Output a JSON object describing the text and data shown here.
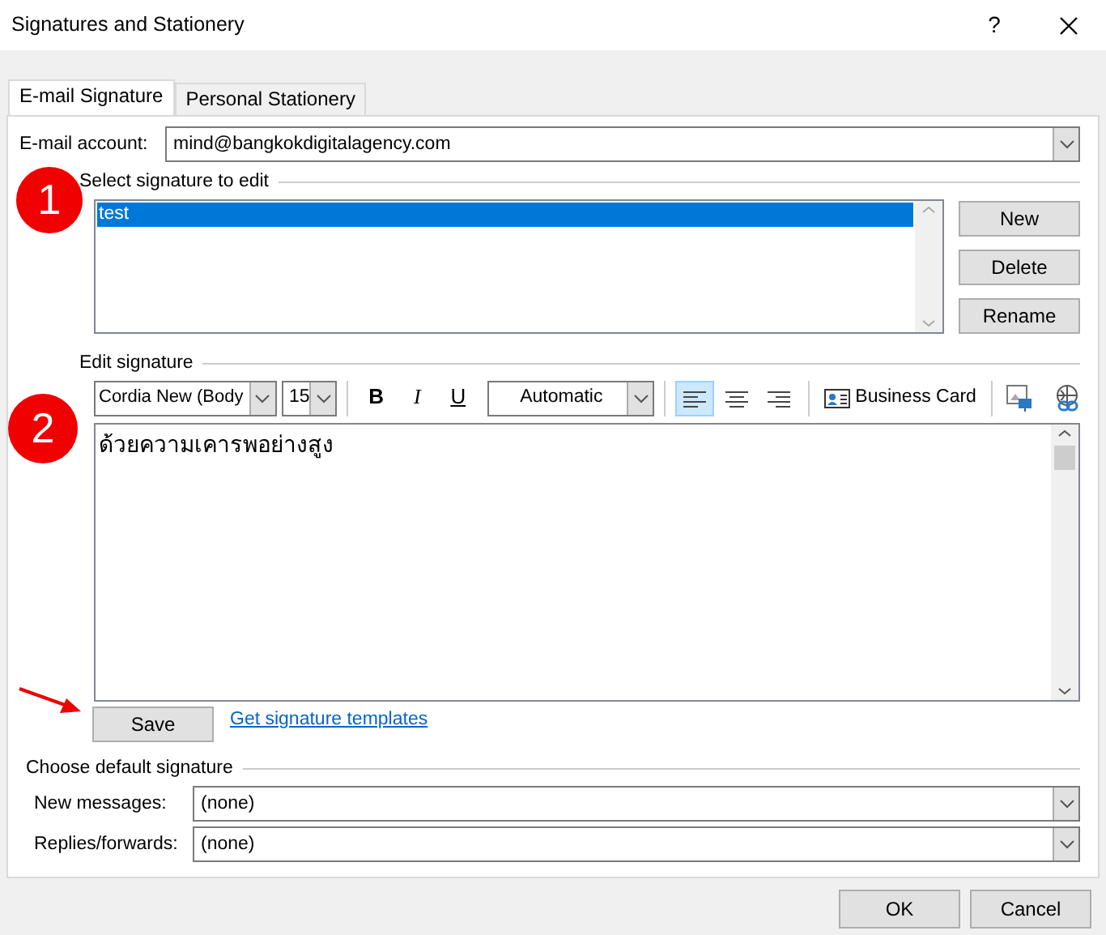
{
  "window": {
    "title": "Signatures and Stationery",
    "help": "?"
  },
  "tabs": [
    {
      "label": "E-mail Signature",
      "selected": true
    },
    {
      "label": "Personal Stationery",
      "selected": false
    }
  ],
  "account": {
    "label": "E-mail account:",
    "value": "mind@bangkokdigitalagency.com"
  },
  "select_signature": {
    "title": "Select signature to edit",
    "signatures": [
      {
        "name": "test",
        "selected": true
      }
    ],
    "buttons": [
      "New",
      "Delete",
      "Rename"
    ]
  },
  "edit_signature": {
    "title": "Edit signature",
    "font": "Cordia New (Body",
    "size": "15",
    "bold": "B",
    "italic": "I",
    "underline": "U",
    "color_picker": "Automatic",
    "alignments": [
      {
        "kind": "left",
        "selected": true
      },
      {
        "kind": "center",
        "selected": false
      },
      {
        "kind": "right",
        "selected": false
      }
    ],
    "business_card": "Business Card",
    "text": "ด้วยความเคารพอย่างสูง"
  },
  "annotations": [
    {
      "label": "1"
    },
    {
      "label": "2"
    }
  ],
  "save": "Save",
  "templates_link": "Get signature templates",
  "defaults": {
    "title": "Choose default signature",
    "rows": [
      {
        "label": "New messages:",
        "value": "(none)"
      },
      {
        "label": "Replies/forwards:",
        "value": "(none)"
      }
    ]
  },
  "footer_buttons": [
    "OK",
    "Cancel"
  ]
}
